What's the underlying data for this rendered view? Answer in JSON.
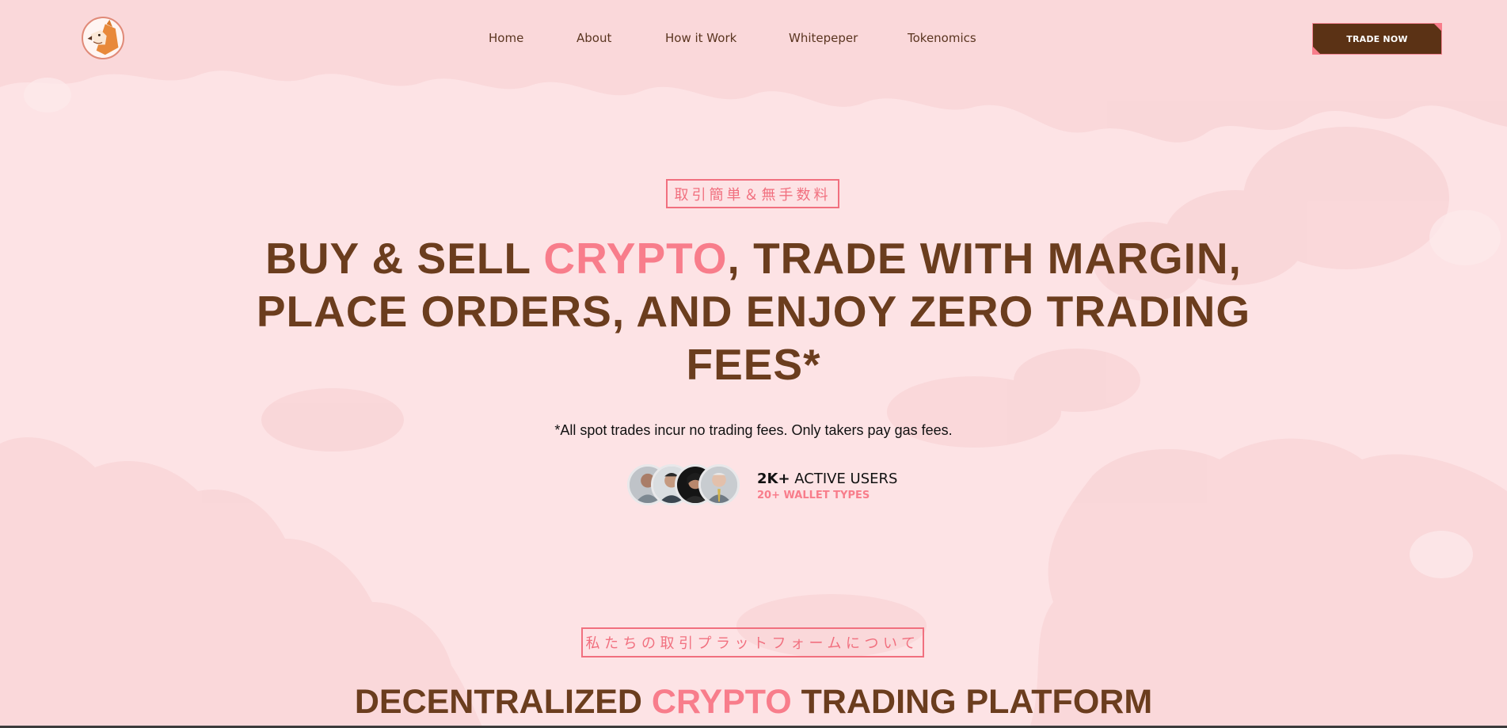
{
  "colors": {
    "background": "#fde3e5",
    "brown": "#6b3d1e",
    "accent": "#f87d8b",
    "button": "#5b3215"
  },
  "header": {
    "logo_icon": "shiba-dog-logo",
    "nav": [
      {
        "label": "Home"
      },
      {
        "label": "About"
      },
      {
        "label": "How it Work"
      },
      {
        "label": "Whitepeper"
      },
      {
        "label": "Tokenomics"
      }
    ],
    "cta_label": "TRADE NOW"
  },
  "hero": {
    "jp_badge": "取引簡単＆無手数料",
    "title_part1": "BUY & SELL ",
    "title_accent": "CRYPTO",
    "title_part2": ", TRADE WITH MARGIN, PLACE ORDERS, AND ENJOY ZERO TRADING FEES*",
    "disclaimer": "*All spot trades incur no trading fees. Only takers pay gas fees.",
    "users_count": "2K+",
    "users_label": " ACTIVE USERS",
    "wallet_types": "20+ WALLET TYPES",
    "avatar_icons": [
      "user-avatar-1",
      "user-avatar-2",
      "user-avatar-3",
      "user-avatar-4"
    ]
  },
  "about": {
    "jp_badge": "私たちの取引プラットフォームについて",
    "title_part1": "DECENTRALIZED ",
    "title_accent": "CRYPTO",
    "title_part2": " TRADING PLATFORM"
  }
}
